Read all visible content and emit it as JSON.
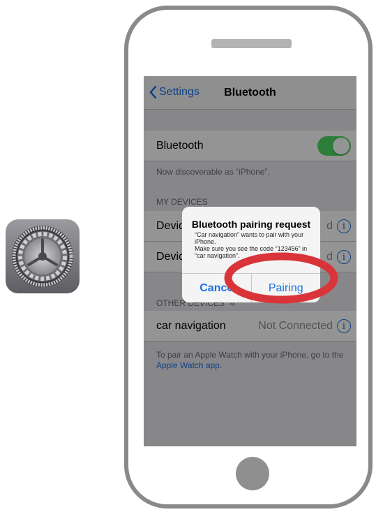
{
  "app_icon": "settings-gear-icon",
  "navbar": {
    "back_label": "Settings",
    "title": "Bluetooth"
  },
  "bluetooth": {
    "label": "Bluetooth",
    "toggle_state": "on",
    "discoverable_text": "Now discoverable as “iPhone”."
  },
  "my_devices": {
    "header": "MY DEVICES",
    "items": [
      {
        "label": "Devic",
        "status": "d"
      },
      {
        "label": "Devic",
        "status": "d"
      }
    ]
  },
  "other_devices": {
    "header": "OTHER DEVICES",
    "items": [
      {
        "label": "car navigation",
        "status": "Not Connected"
      }
    ]
  },
  "footer": {
    "text": "To pair an Apple Watch with your iPhone, go to the ",
    "link": "Apple Watch app",
    "end": "."
  },
  "alert": {
    "title": "Bluetooth pairing request",
    "message_line1": "“Car navigation” wants to pair with your iPhone.",
    "message_line2": "Make sure you see the code “123456” in “car navigation”.",
    "cancel_label": "Cance",
    "confirm_label": "Pairing"
  },
  "colors": {
    "accent": "#1a73e8",
    "toggle_on": "#4cd964",
    "highlight": "#d9343a"
  }
}
